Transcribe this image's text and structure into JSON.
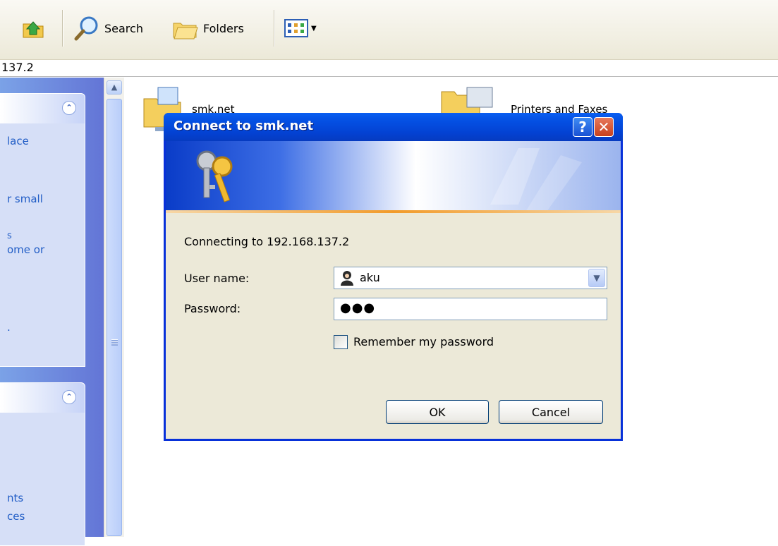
{
  "toolbar": {
    "search_label": "Search",
    "folders_label": "Folders",
    "up_icon": "up-folder-icon",
    "search_icon": "magnifier-icon",
    "folders_icon": "folders-icon",
    "views_icon": "views-icon"
  },
  "address": {
    "text": "137.2"
  },
  "taskpane": {
    "panel1_lines": [
      "lace",
      "r small",
      "s",
      "ome or",
      "."
    ],
    "panel2_lines": [
      "nts",
      "ces"
    ]
  },
  "folders": [
    {
      "label": "smk.net"
    },
    {
      "label": "Printers and Faxes"
    }
  ],
  "dialog": {
    "title": "Connect to smk.net",
    "help_label": "?",
    "close_label": "✕",
    "connecting_text": "Connecting to 192.168.137.2",
    "username_label": "User name:",
    "username_value": "aku",
    "password_label": "Password:",
    "password_value": "●●●",
    "remember_label": "Remember my password",
    "remember_checked": false,
    "ok_label": "OK",
    "cancel_label": "Cancel"
  },
  "colors": {
    "titlebar": "#0553e6",
    "dialog_bg": "#ece9d8",
    "taskpane_text": "#215dc6",
    "close_red": "#c8401c"
  }
}
